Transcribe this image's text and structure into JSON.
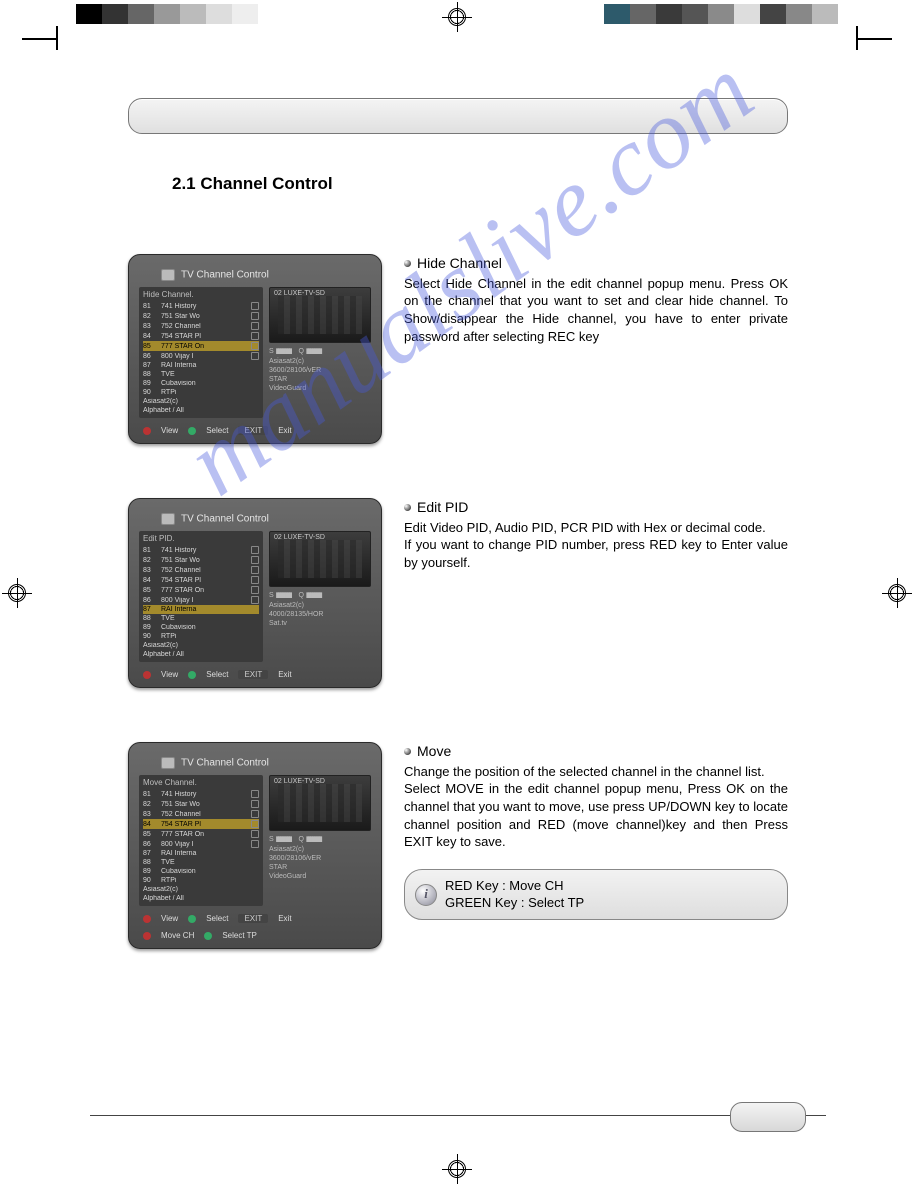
{
  "page": {
    "heading": "2.1 Channel Control",
    "watermark": "manualslive.com"
  },
  "sections": [
    {
      "title": "Hide Channel",
      "body": "Select Hide Channel in the edit channel popup menu. Press OK on the channel that you want to set and clear hide channel. To Show/disappear the Hide channel, you have to enter private password after selecting REC key",
      "screenshot": {
        "window_title": "TV Channel Control",
        "panel_label": "Hide Channel.",
        "preview_label": "02  LUXE-TV-SD",
        "channels": [
          {
            "num": "81",
            "name": "741 History",
            "icon": true
          },
          {
            "num": "82",
            "name": "751 Star Wo",
            "icon": true
          },
          {
            "num": "83",
            "name": "752 Channel",
            "icon": true
          },
          {
            "num": "84",
            "name": "754 STAR Pl",
            "icon": true
          },
          {
            "num": "85",
            "name": "777 STAR On",
            "icon": true,
            "hl": true
          },
          {
            "num": "86",
            "name": "800 Vijay I",
            "icon": true
          },
          {
            "num": "87",
            "name": "RAI Interna",
            "icon": false
          },
          {
            "num": "88",
            "name": "TVE",
            "icon": false
          },
          {
            "num": "89",
            "name": "Cubavision",
            "icon": false
          },
          {
            "num": "90",
            "name": "RTPi",
            "icon": false
          }
        ],
        "footer_left": "Asiasat2(c)",
        "footer_right": "Alphabet / All",
        "info": [
          "Asiasat2(c)",
          "3600/28106/vER",
          "STAR",
          "VideoGuard"
        ],
        "bottom_actions": [
          "View",
          "Select",
          "Exit"
        ]
      }
    },
    {
      "title": "Edit PID",
      "body": "Edit Video PID, Audio PID, PCR PID with Hex or decimal code.\nIf you want to change PID number, press RED key to Enter value by yourself.",
      "screenshot": {
        "window_title": "TV Channel Control",
        "panel_label": "Edit PID.",
        "preview_label": "02  LUXE-TV-SD",
        "channels": [
          {
            "num": "81",
            "name": "741 History",
            "icon": true
          },
          {
            "num": "82",
            "name": "751 Star Wo",
            "icon": true
          },
          {
            "num": "83",
            "name": "752 Channel",
            "icon": true
          },
          {
            "num": "84",
            "name": "754 STAR Pl",
            "icon": true
          },
          {
            "num": "85",
            "name": "777 STAR On",
            "icon": true
          },
          {
            "num": "86",
            "name": "800 Vijay I",
            "icon": true
          },
          {
            "num": "87",
            "name": "RAI Interna",
            "icon": false,
            "hl": true
          },
          {
            "num": "88",
            "name": "TVE",
            "icon": false
          },
          {
            "num": "89",
            "name": "Cubavision",
            "icon": false
          },
          {
            "num": "90",
            "name": "RTPi",
            "icon": false
          }
        ],
        "footer_left": "Asiasat2(c)",
        "footer_right": "Alphabet / All",
        "info": [
          "Asiasat2(c)",
          "4000/28135/HOR",
          "Sat.tv"
        ],
        "bottom_actions": [
          "View",
          "Select",
          "Exit"
        ]
      }
    },
    {
      "title": "Move",
      "body": "Change the position of the selected channel in the channel list.\nSelect MOVE in the edit channel popup menu, Press OK on the channel that you want to move, use press UP/DOWN key to locate channel position and RED (move channel)key and then Press EXIT key to save.",
      "screenshot": {
        "window_title": "TV Channel Control",
        "panel_label": "Move Channel.",
        "preview_label": "02  LUXE-TV-SD",
        "channels": [
          {
            "num": "81",
            "name": "741 History",
            "icon": true
          },
          {
            "num": "82",
            "name": "751 Star Wo",
            "icon": true
          },
          {
            "num": "83",
            "name": "752 Channel",
            "icon": true
          },
          {
            "num": "84",
            "name": "754 STAR Pl",
            "icon": true,
            "hl": true
          },
          {
            "num": "85",
            "name": "777 STAR On",
            "icon": true
          },
          {
            "num": "86",
            "name": "800 Vijay I",
            "icon": true
          },
          {
            "num": "87",
            "name": "RAI Interna",
            "icon": false
          },
          {
            "num": "88",
            "name": "TVE",
            "icon": false
          },
          {
            "num": "89",
            "name": "Cubavision",
            "icon": false
          },
          {
            "num": "90",
            "name": "RTPi",
            "icon": false
          }
        ],
        "footer_left": "Asiasat2(c)",
        "footer_right": "Alphabet / All",
        "info": [
          "Asiasat2(c)",
          "3600/28106/vER",
          "STAR",
          "VideoGuard"
        ],
        "bottom_actions": [
          "View",
          "Select",
          "Exit"
        ],
        "extra_actions": [
          "Move CH",
          "Select TP"
        ]
      },
      "hint": {
        "line1": "RED Key : Move CH",
        "line2": "GREEN Key : Select TP"
      }
    }
  ],
  "signal": {
    "s_label": "S",
    "q_label": "Q"
  }
}
